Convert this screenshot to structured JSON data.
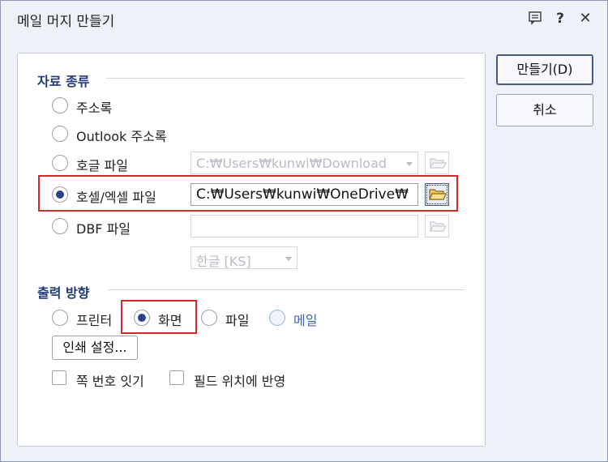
{
  "dialog": {
    "title": "메일 머지 만들기",
    "help_glyph": "?",
    "close_glyph": "✕"
  },
  "source_type": {
    "title": "자료 종류",
    "options": [
      {
        "label": "주소록",
        "selected": false
      },
      {
        "label": "Outlook 주소록",
        "selected": false
      },
      {
        "label": "호글 파일",
        "selected": false,
        "path": "C:₩Users₩kunwi₩Download"
      },
      {
        "label": "호셀/엑셀 파일",
        "selected": true,
        "path": "C:₩Users₩kunwi₩OneDrive₩"
      },
      {
        "label": "DBF 파일",
        "selected": false,
        "path": ""
      }
    ],
    "encoding": "한글 [KS]"
  },
  "output": {
    "title": "출력 방향",
    "options": [
      {
        "label": "프린터",
        "selected": false
      },
      {
        "label": "화면",
        "selected": true
      },
      {
        "label": "파일",
        "selected": false
      },
      {
        "label": "메일",
        "selected": false
      }
    ],
    "print_settings_label": "인쇄 설정...",
    "checkboxes": [
      {
        "label": "쪽 번호 잇기",
        "checked": false
      },
      {
        "label": "필드 위치에 반영",
        "checked": false
      }
    ]
  },
  "buttons": {
    "create_label": "만들기(D)",
    "cancel_label": "취소"
  },
  "colors": {
    "accent": "#2d4384",
    "section_title": "#233a7a",
    "highlight": "#d42a2a"
  },
  "icons": [
    "comment-icon",
    "help-icon",
    "close-icon",
    "folder-icon",
    "dropdown-arrow-icon"
  ]
}
